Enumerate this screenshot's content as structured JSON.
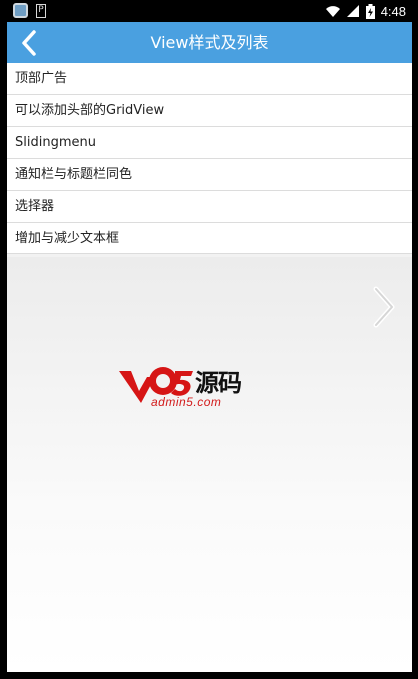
{
  "status_bar": {
    "time": "4:48",
    "icons": [
      "app-icon",
      "p-notification-icon",
      "wifi-icon",
      "signal-icon",
      "battery-icon"
    ]
  },
  "title_bar": {
    "title": "View样式及列表",
    "back_icon": "chevron-left-icon",
    "color": "#4aa0e0"
  },
  "list": {
    "items": [
      {
        "label": "顶部广告"
      },
      {
        "label": "可以添加头部的GridView"
      },
      {
        "label": "Slidingmenu"
      },
      {
        "label": "通知栏与标题栏同色"
      },
      {
        "label": "选择器"
      },
      {
        "label": "增加与减少文本框"
      }
    ]
  },
  "content": {
    "next_icon": "chevron-right-icon",
    "watermark": {
      "mark": "a5",
      "text": "源码",
      "url": "admin5.com"
    }
  }
}
